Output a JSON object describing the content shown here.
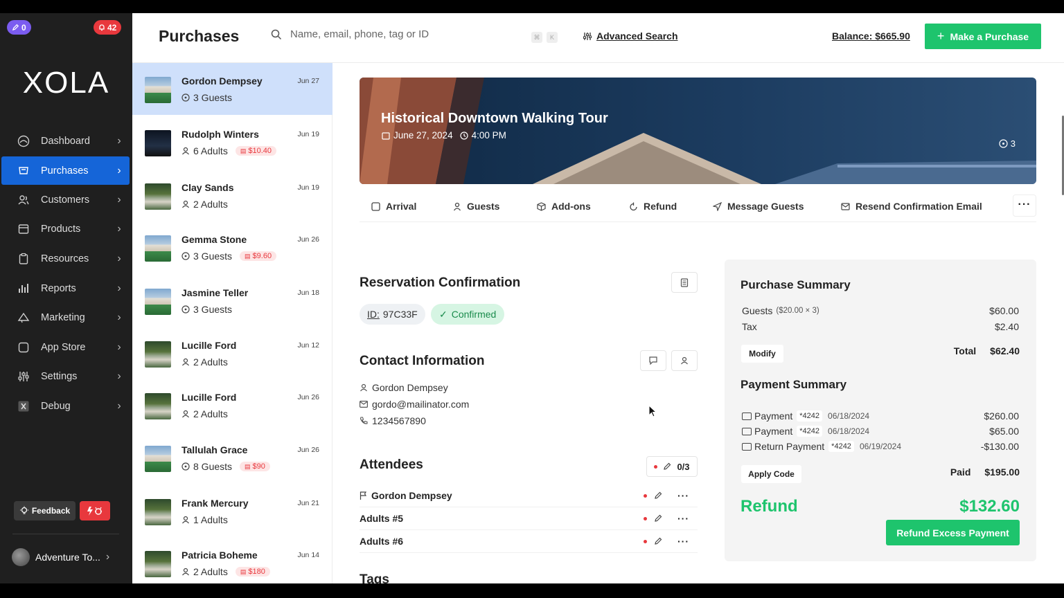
{
  "badges": {
    "notes": "0",
    "alerts": "42"
  },
  "app": {
    "logo": "XOLA"
  },
  "nav": [
    {
      "label": "Dashboard",
      "icon": "dashboard-icon"
    },
    {
      "label": "Purchases",
      "icon": "purchases-icon"
    },
    {
      "label": "Customers",
      "icon": "customers-icon"
    },
    {
      "label": "Products",
      "icon": "products-icon"
    },
    {
      "label": "Resources",
      "icon": "resources-icon"
    },
    {
      "label": "Reports",
      "icon": "reports-icon"
    },
    {
      "label": "Marketing",
      "icon": "marketing-icon"
    },
    {
      "label": "App Store",
      "icon": "app-store-icon"
    },
    {
      "label": "Settings",
      "icon": "settings-icon"
    },
    {
      "label": "Debug",
      "icon": "debug-icon"
    }
  ],
  "feedback": {
    "label": "Feedback"
  },
  "account": {
    "name": "Adventure To..."
  },
  "header": {
    "title": "Purchases",
    "search_placeholder": "Name, email, phone, tag or ID",
    "kbd1": "⌘",
    "kbd2": "K",
    "advanced_search": "Advanced Search",
    "balance": "Balance: $665.90",
    "make_purchase": "Make a Purchase"
  },
  "purchases": [
    {
      "name": "Gordon Dempsey",
      "date": "Jun 27",
      "sub": "3 Guests",
      "due": "",
      "thumb": "bank"
    },
    {
      "name": "Rudolph Winters",
      "date": "Jun 19",
      "sub": "6 Adults",
      "due": "$10.40",
      "thumb": "night"
    },
    {
      "name": "Clay Sands",
      "date": "Jun 19",
      "sub": "2 Adults",
      "due": "",
      "thumb": "forest"
    },
    {
      "name": "Gemma Stone",
      "date": "Jun 26",
      "sub": "3 Guests",
      "due": "$9.60",
      "thumb": "bank"
    },
    {
      "name": "Jasmine Teller",
      "date": "Jun 18",
      "sub": "3 Guests",
      "due": "",
      "thumb": "bank"
    },
    {
      "name": "Lucille Ford",
      "date": "Jun 12",
      "sub": "2 Adults",
      "due": "",
      "thumb": "forest"
    },
    {
      "name": "Lucille Ford",
      "date": "Jun 26",
      "sub": "2 Adults",
      "due": "",
      "thumb": "forest"
    },
    {
      "name": "Tallulah Grace",
      "date": "Jun 26",
      "sub": "8 Guests",
      "due": "$90",
      "thumb": "bank"
    },
    {
      "name": "Frank Mercury",
      "date": "Jun 21",
      "sub": "1 Adults",
      "due": "",
      "thumb": "forest"
    },
    {
      "name": "Patricia Boheme",
      "date": "Jun 14",
      "sub": "2 Adults",
      "due": "$180",
      "thumb": "forest"
    }
  ],
  "event": {
    "title": "Historical Downtown Walking Tour",
    "date": "June 27, 2024",
    "time": "4:00 PM",
    "count": "3"
  },
  "actions": [
    "Arrival",
    "Guests",
    "Add-ons",
    "Refund",
    "Message Guests",
    "Resend Confirmation Email"
  ],
  "reservation": {
    "title": "Reservation Confirmation",
    "id_label": "ID:",
    "id": "97C33F",
    "status": "Confirmed"
  },
  "contact": {
    "title": "Contact Information",
    "name": "Gordon Dempsey",
    "email": "gordo@mailinator.com",
    "phone": "1234567890"
  },
  "attendees": {
    "title": "Attendees",
    "count": "0/3",
    "rows": [
      "Gordon Dempsey",
      "Adults #5",
      "Adults #6"
    ]
  },
  "tags": {
    "title": "Tags"
  },
  "purchase_summary": {
    "title": "Purchase Summary",
    "guests_label": "Guests",
    "guests_detail": "($20.00 × 3)",
    "guests_value": "$60.00",
    "tax_label": "Tax",
    "tax_value": "$2.40",
    "modify": "Modify",
    "total_label": "Total",
    "total_value": "$62.40"
  },
  "payment_summary": {
    "title": "Payment Summary",
    "rows": [
      {
        "label": "Payment",
        "card": "*4242",
        "date": "06/18/2024",
        "amount": "$260.00"
      },
      {
        "label": "Payment",
        "card": "*4242",
        "date": "06/18/2024",
        "amount": "$65.00"
      },
      {
        "label": "Return Payment",
        "card": "*4242",
        "date": "06/19/2024",
        "amount": "-$130.00"
      }
    ],
    "apply_code": "Apply Code",
    "paid_label": "Paid",
    "paid_value": "$195.00",
    "refund_label": "Refund",
    "refund_value": "$132.60",
    "refund_button": "Refund Excess Payment"
  },
  "colors": {
    "accent": "#1565d8",
    "success": "#1ec46d",
    "danger": "#e8383d",
    "sidebar": "#1f1f1f"
  }
}
